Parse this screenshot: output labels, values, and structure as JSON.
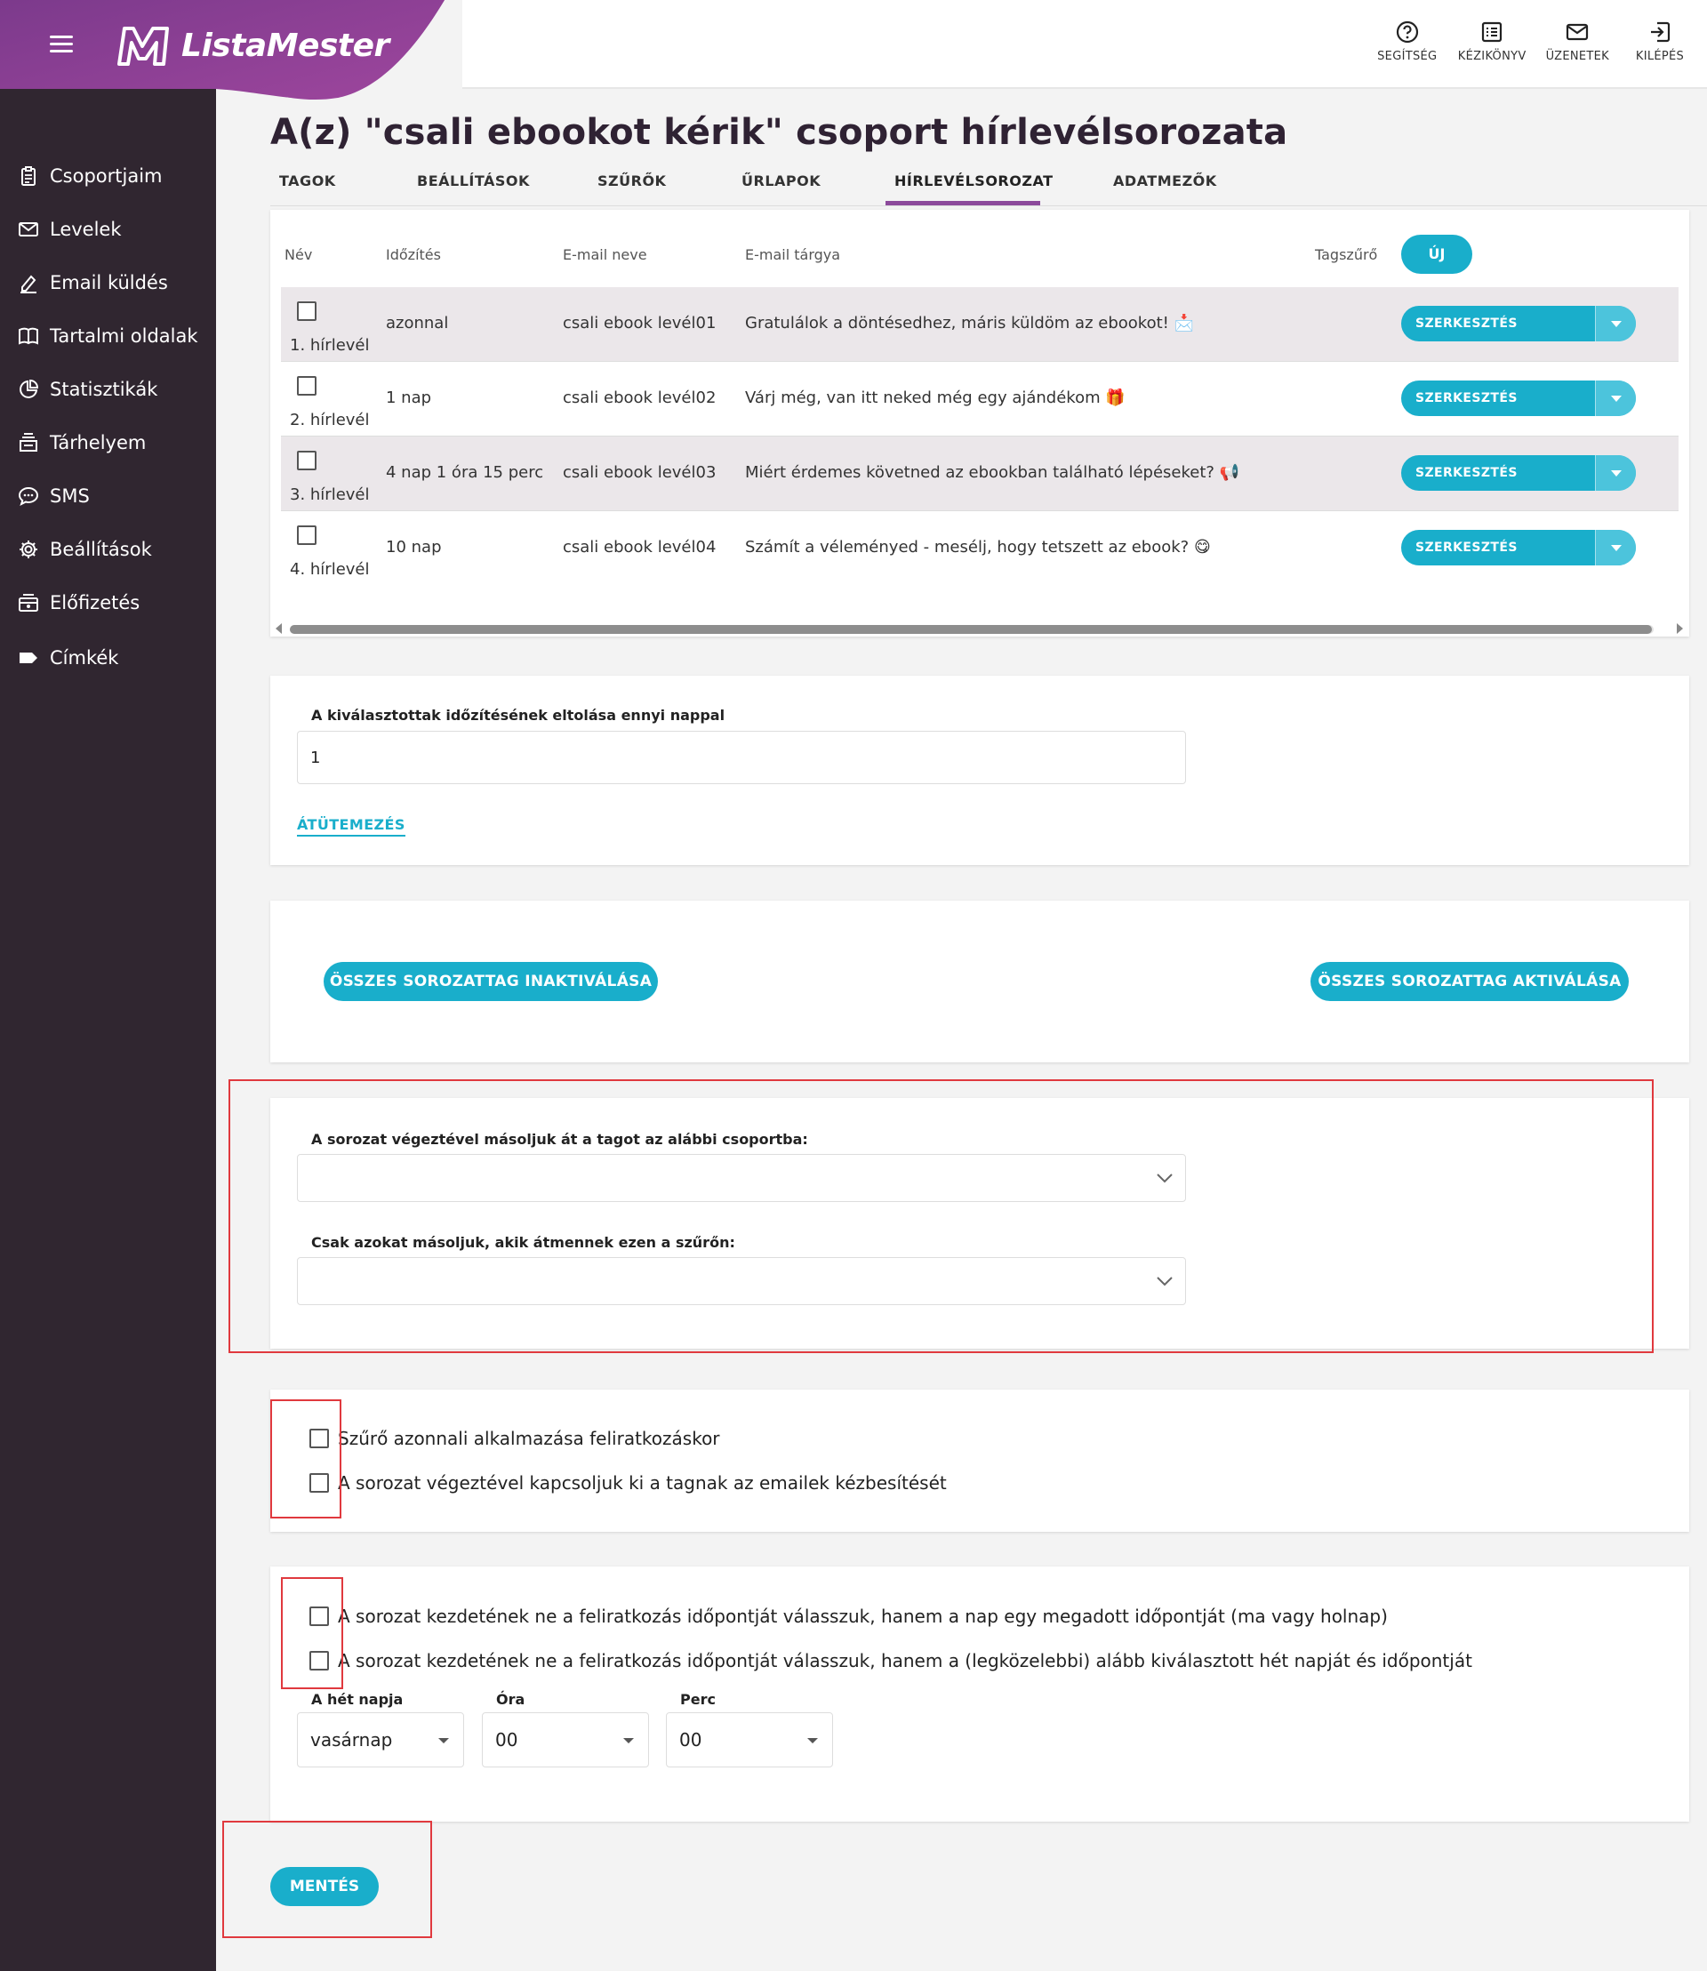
{
  "app": {
    "name": "ListaMester"
  },
  "header": {
    "actions": [
      {
        "label": "SEGÍTSÉG",
        "icon": "help-circle-icon"
      },
      {
        "label": "KÉZIKÖNYV",
        "icon": "manual-list-icon"
      },
      {
        "label": "ÜZENETEK",
        "icon": "mail-icon"
      },
      {
        "label": "KILÉPÉS",
        "icon": "logout-icon"
      }
    ]
  },
  "sidebar": {
    "items": [
      {
        "label": "Csoportjaim",
        "icon": "clipboard-icon"
      },
      {
        "label": "Levelek",
        "icon": "envelope-icon"
      },
      {
        "label": "Email küldés",
        "icon": "pen-icon"
      },
      {
        "label": "Tartalmi oldalak",
        "icon": "book-icon"
      },
      {
        "label": "Statisztikák",
        "icon": "pie-chart-icon"
      },
      {
        "label": "Tárhelyem",
        "icon": "storage-icon"
      },
      {
        "label": "SMS",
        "icon": "sms-bubble-icon"
      },
      {
        "label": "Beállítások",
        "icon": "gear-icon"
      },
      {
        "label": "Előfizetés",
        "icon": "subscription-icon"
      },
      {
        "label": "Címkék",
        "icon": "tag-icon"
      }
    ]
  },
  "page": {
    "title": "A(z) \"csali ebookot kérik\" csoport hírlevélsorozata"
  },
  "tabs": [
    {
      "label": "TAGOK"
    },
    {
      "label": "BEÁLLÍTÁSOK"
    },
    {
      "label": "SZŰRŐK"
    },
    {
      "label": "ŰRLAPOK"
    },
    {
      "label": "HÍRLEVÉLSOROZAT",
      "active": true
    },
    {
      "label": "ADATMEZŐK"
    }
  ],
  "table": {
    "headers": {
      "name": "Név",
      "timing": "Időzítés",
      "email_name": "E-mail neve",
      "subject": "E-mail tárgya",
      "filter": "Tagszűrő"
    },
    "new_button": "ÚJ",
    "edit_label": "SZERKESZTÉS",
    "rows": [
      {
        "name": "1. hírlevél",
        "timing": "azonnal",
        "email_name": "csali ebook levél01",
        "subject": "Gratulálok a döntésedhez, máris küldöm az ebookot! 📩"
      },
      {
        "name": "2. hírlevél",
        "timing": "1 nap",
        "email_name": "csali ebook levél02",
        "subject": "Várj még, van itt neked még egy ajándékom 🎁"
      },
      {
        "name": "3. hírlevél",
        "timing": "4 nap 1 óra 15 perc",
        "email_name": "csali ebook levél03",
        "subject": "Miért érdemes követned az ebookban található lépéseket? 📢"
      },
      {
        "name": "4. hírlevél",
        "timing": "10 nap",
        "email_name": "csali ebook levél04",
        "subject": "Számít a véleményed - mesélj, hogy tetszett az ebook? 😋"
      }
    ]
  },
  "reschedule": {
    "label": "A kiválasztottak időzítésének eltolása ennyi nappal",
    "value": "1",
    "link": "ÁTÜTEMEZÉS"
  },
  "bulk": {
    "deactivate": "ÖSSZES SOROZATTAG INAKTIVÁLÁSA",
    "activate": "ÖSSZES SOROZATTAG AKTIVÁLÁSA"
  },
  "copy": {
    "group_label": "A sorozat végeztével másoljuk át a tagot az alábbi csoportba:",
    "filter_label": "Csak azokat másoljuk, akik átmennek ezen a szűrőn:"
  },
  "options": {
    "apply_filter": "Szűrő azonnali alkalmazása feliratkozáskor",
    "disable_delivery": "A sorozat végeztével kapcsoljuk ki a tagnak az emailek kézbesítését"
  },
  "start": {
    "by_day_time": "A sorozat kezdetének ne a feliratkozás időpontját válasszuk, hanem a nap egy megadott időpontját (ma vagy holnap)",
    "by_weekday": "A sorozat kezdetének ne a feliratkozás időpontját válasszuk, hanem a (legközelebbi) alább kiválasztott hét napját és időpontját",
    "weekday_label": "A hét napja",
    "weekday_value": "vasárnap",
    "hour_label": "Óra",
    "hour_value": "00",
    "minute_label": "Perc",
    "minute_value": "00"
  },
  "save": "MENTÉS",
  "colors": {
    "accent": "#19aecb",
    "sidebar": "#302630",
    "brand": "#8c4a9b",
    "highlight": "#e0393e"
  }
}
